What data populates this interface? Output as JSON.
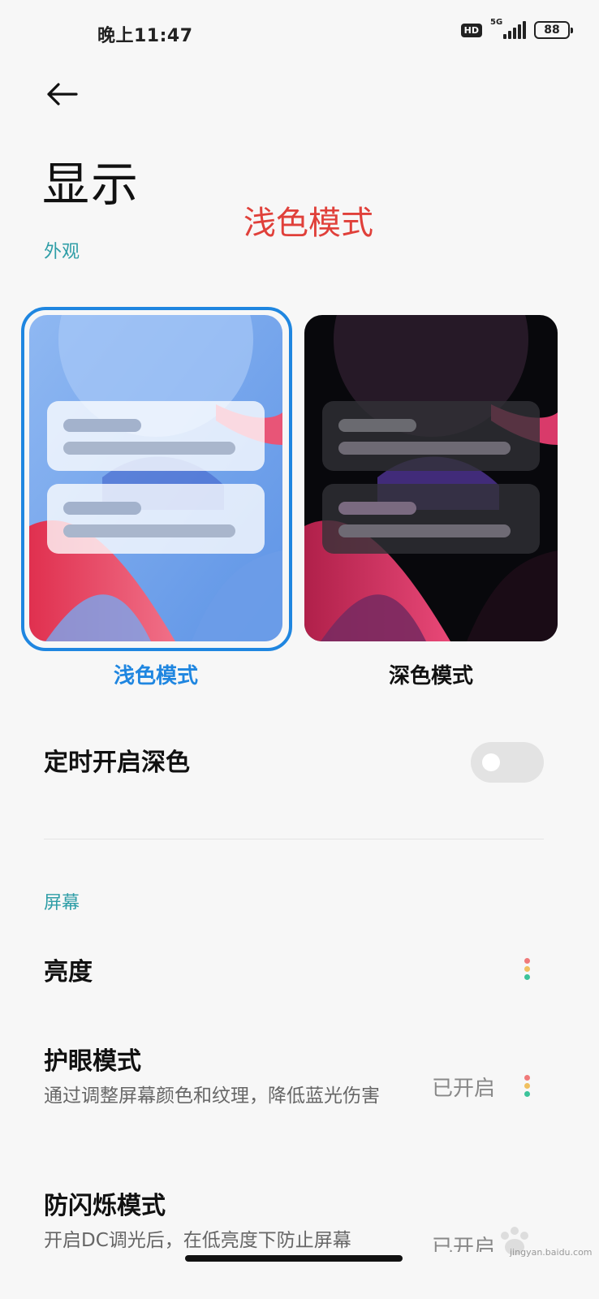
{
  "status_bar": {
    "time": "晚上11:47",
    "hd": "HD",
    "network": "5G",
    "battery": "88"
  },
  "header": {
    "title": "显示",
    "overlay_caption": "浅色模式"
  },
  "appearance": {
    "section_label": "外观",
    "light_label": "浅色模式",
    "dark_label": "深色模式",
    "selected": "浅色模式",
    "accent_color": "#1f86e0"
  },
  "schedule_dark": {
    "label": "定时开启深色",
    "enabled": false
  },
  "screen": {
    "section_label": "屏幕",
    "items": [
      {
        "title": "亮度",
        "subtitle": "",
        "value": ""
      },
      {
        "title": "护眼模式",
        "subtitle": "通过调整屏幕颜色和纹理，降低蓝光伤害",
        "value": "已开启"
      },
      {
        "title": "防闪烁模式",
        "subtitle": "开启DC调光后，在低亮度下防止屏幕",
        "value": "已开启"
      }
    ]
  },
  "watermark": {
    "text": "jingyan.baidu.com"
  }
}
